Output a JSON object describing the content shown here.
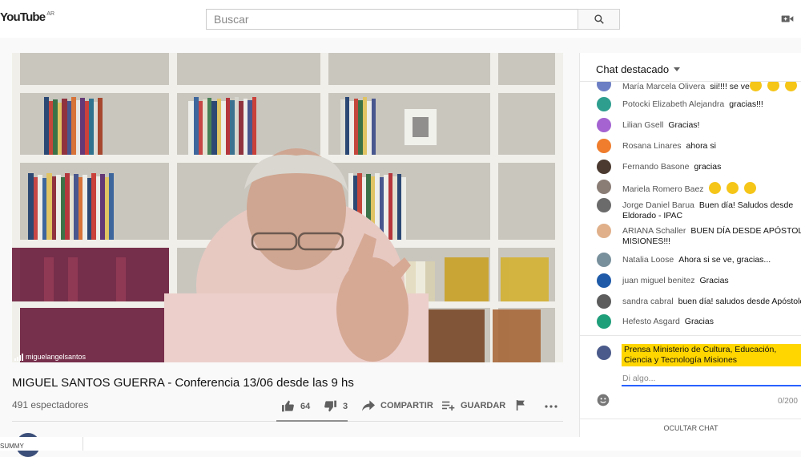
{
  "header": {
    "logo": "YouTube",
    "region": "AR",
    "search_placeholder": "Buscar"
  },
  "video": {
    "watermark": "miguelangelsantos",
    "title": "MIGUEL SANTOS GUERRA - Conferencia 13/06 desde las 9 hs",
    "views": "491 espectadores"
  },
  "actions": {
    "likes": "64",
    "dislikes": "3",
    "share": "COMPARTIR",
    "save": "GUARDAR"
  },
  "bottom": {
    "text": "SUMMY"
  },
  "chat": {
    "title": "Chat destacado",
    "messages": [
      {
        "author": "María Marcela Olivera",
        "text": "sii!!!! se ve",
        "emoji": 3,
        "color": "#6d7fc4"
      },
      {
        "author": "Potocki Elizabeth Alejandra",
        "text": "gracias!!!",
        "emoji": 0,
        "color": "#2e9e8f"
      },
      {
        "author": "Lilian Gsell",
        "text": "Gracias!",
        "emoji": 0,
        "color": "#a463d1"
      },
      {
        "author": "Rosana Linares",
        "text": "ahora si",
        "emoji": 0,
        "color": "#ef7d2d"
      },
      {
        "author": "Fernando Basone",
        "text": "gracias",
        "emoji": 0,
        "color": "#4a3a30"
      },
      {
        "author": "Mariela Romero Baez",
        "text": "",
        "emoji": 3,
        "color": "#8a7d76"
      },
      {
        "author": "Jorge Daniel Barua",
        "text": "Buen día! Saludos desde Eldorado - IPAC",
        "emoji": 0,
        "color": "#6b6b6b"
      },
      {
        "author": "ARIANA Schaller",
        "text": "BUEN DÍA DESDE APÓSTOLES MISIONES!!!",
        "emoji": 0,
        "color": "#e0b08a"
      },
      {
        "author": "Natalia Loose",
        "text": "Ahora si se ve, gracias...",
        "emoji": 0,
        "color": "#78909c"
      },
      {
        "author": "juan miguel benitez",
        "text": "Gracias",
        "emoji": 0,
        "color": "#1e5aa8"
      },
      {
        "author": "sandra cabral",
        "text": "buen día! saludos desde Apóstoles",
        "emoji": 0,
        "color": "#5c5c5c"
      },
      {
        "author": "Hefesto Asgard",
        "text": "Gracias",
        "emoji": 0,
        "color": "#1f9e7a"
      }
    ],
    "input_name": "Prensa Ministerio de Cultura, Educación, Ciencia y Tecnología Misiones",
    "input_placeholder": "Di algo...",
    "counter": "0/200",
    "hide_label": "OCULTAR CHAT"
  }
}
